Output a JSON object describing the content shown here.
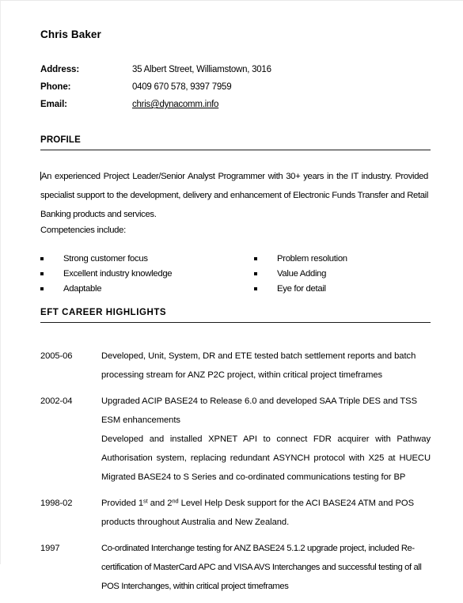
{
  "header": {
    "name": "Chris Baker",
    "contact": [
      {
        "label": "Address:",
        "value": "35 Albert Street, Williamstown, 3016",
        "type": "text"
      },
      {
        "label": "Phone:",
        "value": "0409 670 578, 9397 7959",
        "type": "text"
      },
      {
        "label": "Email:",
        "value": "chris@dynacomm.info",
        "type": "link"
      }
    ]
  },
  "profile": {
    "heading": "PROFILE",
    "paragraph": "An experienced Project Leader/Senior Analyst Programmer with 30+ years in the IT industry. Provided specialist support to the development, delivery and enhancement of Electronic Funds Transfer and Retail Banking products and services.",
    "competencies_intro": "Competencies include:",
    "competencies_left": [
      "Strong customer focus",
      "Excellent industry knowledge",
      "Adaptable"
    ],
    "competencies_right": [
      "Problem resolution",
      "Value Adding",
      "Eye for detail"
    ]
  },
  "career": {
    "heading": "EFT CAREER HIGHLIGHTS",
    "entries": [
      {
        "year": "2005-06",
        "paragraphs": [
          "Developed, Unit, System, DR and ETE tested batch settlement reports and batch processing stream for ANZ P2C project, within critical project timeframes"
        ]
      },
      {
        "year": "2002-04",
        "paragraphs": [
          "Upgraded ACIP BASE24 to Release 6.0 and developed SAA Triple DES and TSS ESM enhancements",
          "Developed and installed XPNET API to connect FDR acquirer with Pathway Authorisation system, replacing redundant ASYNCH protocol with X25 at HUECU Migrated BASE24 to S Series and co-ordinated communications testing for BP"
        ]
      },
      {
        "year": "1998-02",
        "paragraphs_html": [
          "Provided 1<sup>st</sup> and 2<sup>nd</sup> Level Help Desk support for the ACI BASE24 ATM and POS products throughout Australia and New Zealand."
        ]
      },
      {
        "year": "1997",
        "paragraphs": [
          "Co-ordinated Interchange testing for ANZ BASE24 5.1.2 upgrade project, included Re-certification of MasterCard APC and VISA AVS Interchanges and successful testing of all POS Interchanges, within critical project timeframes"
        ]
      }
    ]
  }
}
